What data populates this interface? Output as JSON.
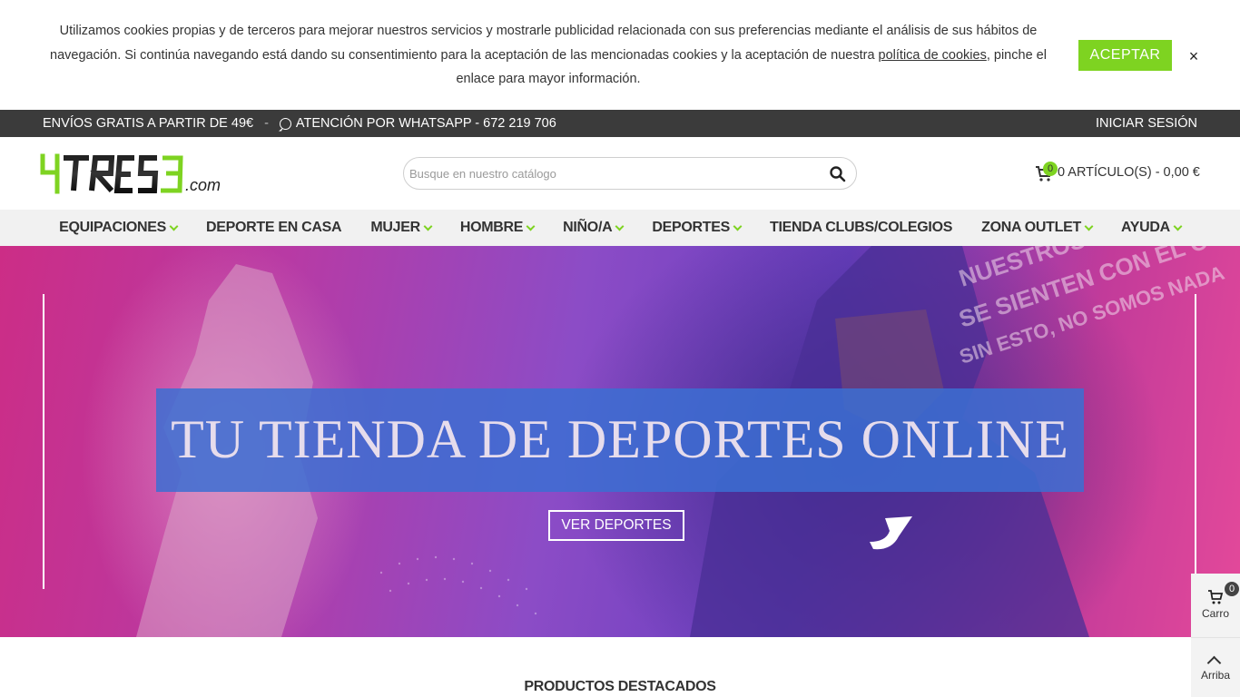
{
  "cookie_banner": {
    "text_before_link": "Utilizamos cookies propias y de terceros para mejorar nuestros servicios y mostrarle publicidad relacionada con sus preferencias mediante el análisis de sus hábitos de navegación. Si continúa navegando está dando su consentimiento para la aceptación de las mencionadas cookies y la aceptación de nuestra ",
    "link_text": "política de cookies",
    "text_after_link": ", pinche el enlace para mayor información.",
    "accept_label": "ACEPTAR",
    "close_label": "×"
  },
  "topbar": {
    "shipping": "ENVÍOS GRATIS A PARTIR DE 49€",
    "separator": "-",
    "whatsapp": "ATENCIÓN POR WHATSAPP - 672 219 706",
    "login": "INICIAR SESIÓN"
  },
  "header": {
    "logo_main": "4TRES3",
    "logo_suffix": ".com",
    "search_placeholder": "Busque en nuestro catálogo",
    "cart_count": "0",
    "cart_summary": "0 ARTÍCULO(S) - 0,00 €"
  },
  "nav": {
    "items": [
      {
        "label": "EQUIPACIONES",
        "dropdown": true
      },
      {
        "label": "DEPORTE EN CASA",
        "dropdown": false
      },
      {
        "label": "MUJER",
        "dropdown": true
      },
      {
        "label": "HOMBRE",
        "dropdown": true
      },
      {
        "label": "NIÑO/A",
        "dropdown": true
      },
      {
        "label": "DEPORTES",
        "dropdown": true
      },
      {
        "label": "TIENDA CLUBS/COLEGIOS",
        "dropdown": false
      },
      {
        "label": "ZONA OUTLET",
        "dropdown": true
      },
      {
        "label": "AYUDA",
        "dropdown": true
      }
    ]
  },
  "hero": {
    "title": "TU TIENDA DE DEPORTES ONLINE",
    "button": "VER DEPORTES",
    "shirt_text": [
      "NUESTROS COLORS",
      "SE SIENTEN CON EL CORAZÓN",
      "SIN ESTO, NO SOMOS NADA"
    ]
  },
  "featured": {
    "title": "PRODUCTOS DESTACADOS"
  },
  "float_widgets": {
    "cart_count": "0",
    "cart_label": "Carro",
    "top_label": "Arriba"
  },
  "colors": {
    "accent": "#7ed321",
    "topbar_bg": "#3b3b3b",
    "nav_bg": "#f1f1f1",
    "hero_title_box": "#3b6ed2"
  }
}
